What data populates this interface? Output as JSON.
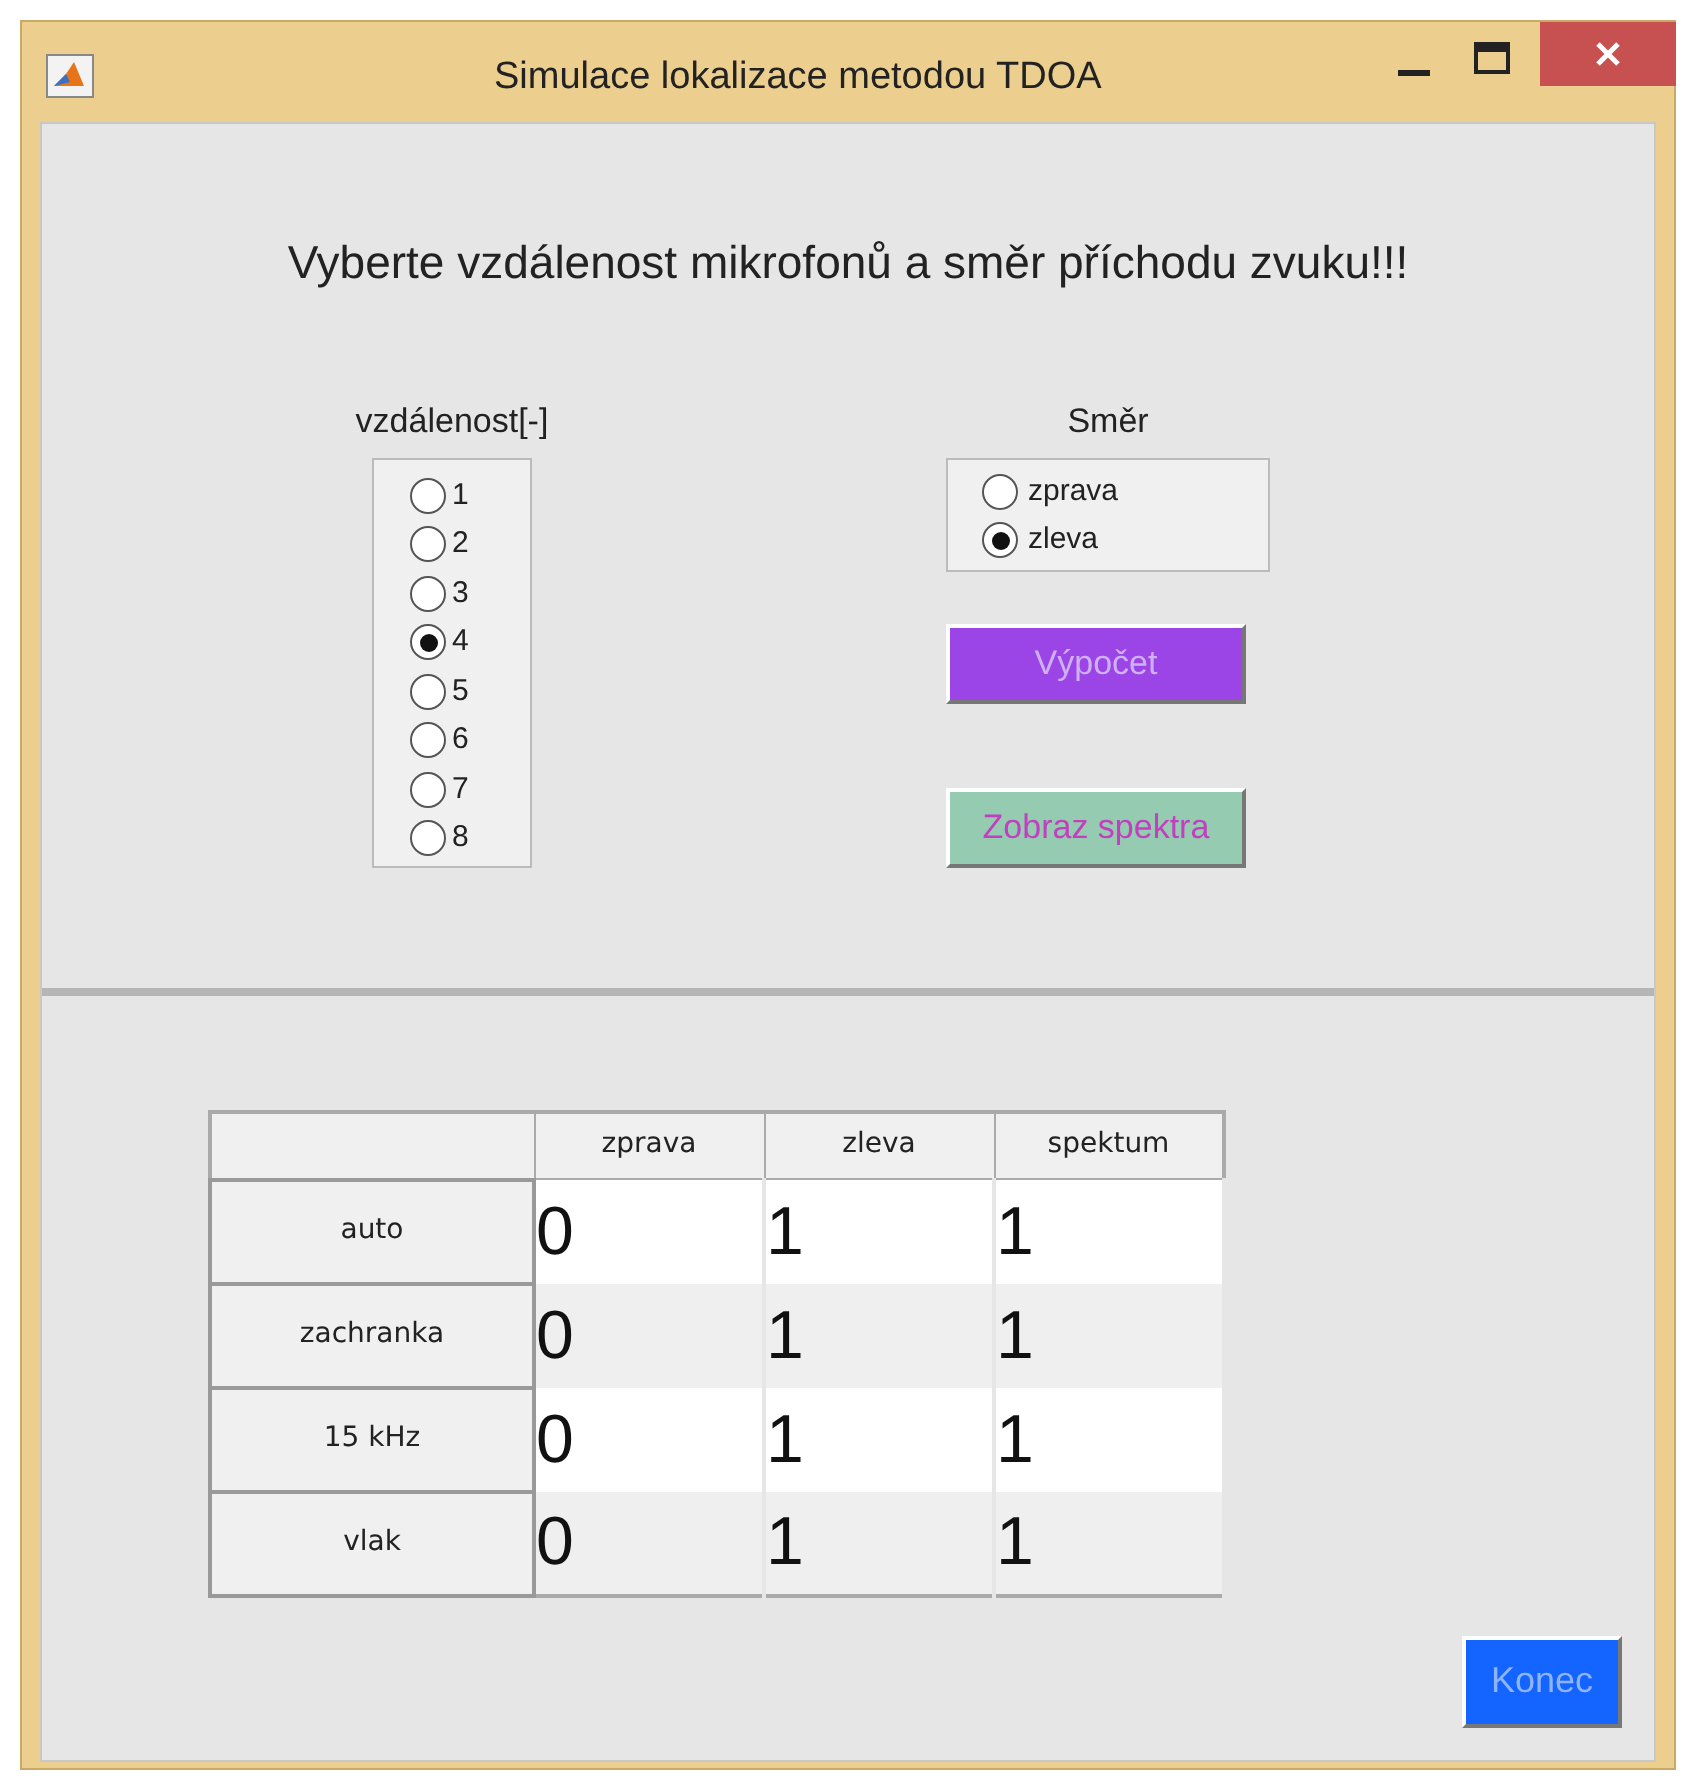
{
  "window": {
    "title": "Simulace lokalizace metodou TDOA"
  },
  "heading": "Vyberte vzdálenost mikrofonů a směr příchodu zvuku!!!",
  "distance": {
    "label": "vzdálenost[-]",
    "options": [
      {
        "label": "1",
        "selected": false
      },
      {
        "label": "2",
        "selected": false
      },
      {
        "label": "3",
        "selected": false
      },
      {
        "label": "4",
        "selected": true
      },
      {
        "label": "5",
        "selected": false
      },
      {
        "label": "6",
        "selected": false
      },
      {
        "label": "7",
        "selected": false
      },
      {
        "label": "8",
        "selected": false
      }
    ]
  },
  "direction": {
    "label": "Směr",
    "options": [
      {
        "label": "zprava",
        "selected": false
      },
      {
        "label": "zleva",
        "selected": true
      }
    ]
  },
  "buttons": [
    {
      "kind": "compute",
      "label": "Výpočet",
      "color": "#9b45e6"
    },
    {
      "kind": "spectra",
      "label": "Zobraz spektra",
      "color": "#95cbb0"
    }
  ],
  "table": {
    "columns": [
      "zprava",
      "zleva",
      "spektum"
    ],
    "rows": [
      {
        "label": "auto",
        "cells": [
          "0",
          "1",
          "1"
        ]
      },
      {
        "label": "zachranka",
        "cells": [
          "0",
          "1",
          "1"
        ]
      },
      {
        "label": "15 kHz",
        "cells": [
          "0",
          "1",
          "1"
        ]
      },
      {
        "label": "vlak",
        "cells": [
          "0",
          "1",
          "1"
        ]
      }
    ]
  },
  "exit_button": {
    "label": "Konec",
    "color": "#1464ff"
  }
}
